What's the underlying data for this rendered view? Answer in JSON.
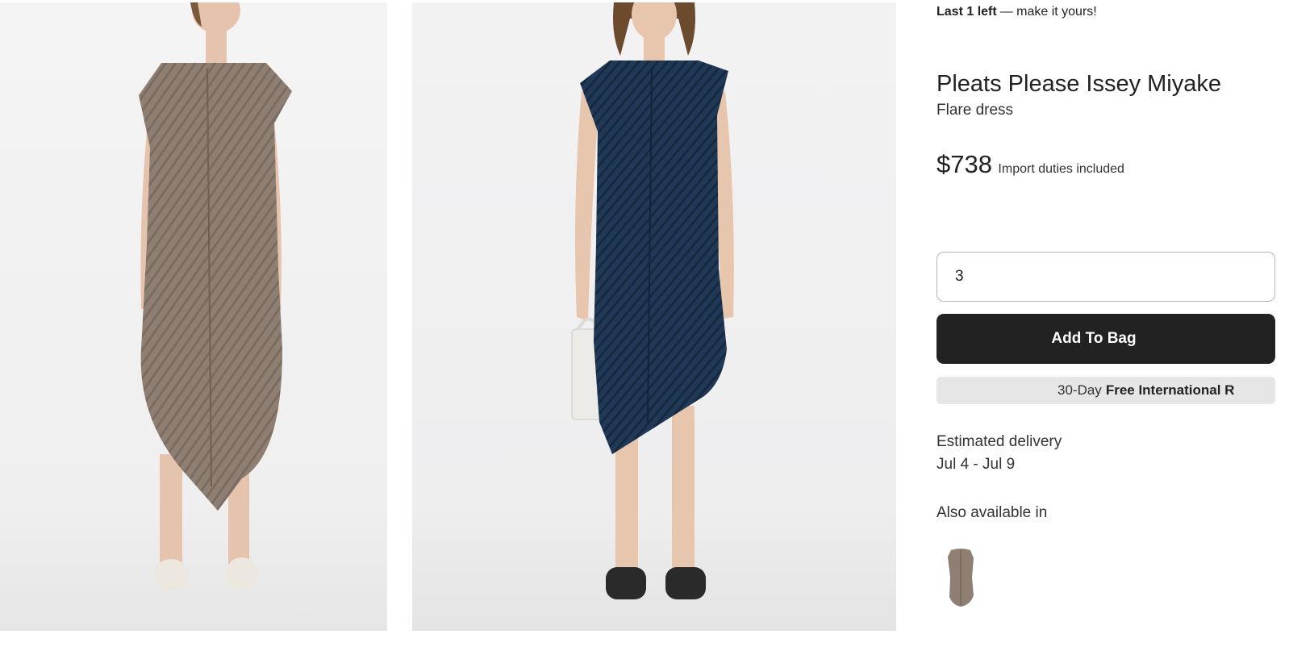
{
  "stock": {
    "count_text": "Last 1 left",
    "message": "— make it yours!"
  },
  "product": {
    "brand": "Pleats Please Issey Miyake",
    "name": "Flare dress",
    "price": "$738",
    "duties_note": "Import duties included"
  },
  "quantity": {
    "value": "3"
  },
  "actions": {
    "add_to_bag": "Add To Bag"
  },
  "returns": {
    "prefix": "30-Day",
    "bold": "Free International R"
  },
  "delivery": {
    "label": "Estimated delivery",
    "dates": "Jul 4 - Jul 9"
  },
  "also_available": {
    "label": "Also available in"
  },
  "colors": {
    "button_bg": "#222222",
    "returns_bg": "#e6e6e6",
    "dress_taupe": "#8e7f72",
    "dress_navy": "#1f3957"
  },
  "gallery": {
    "images": [
      {
        "icon": "dress-photo-taupe"
      },
      {
        "icon": "dress-photo-navy"
      }
    ]
  }
}
